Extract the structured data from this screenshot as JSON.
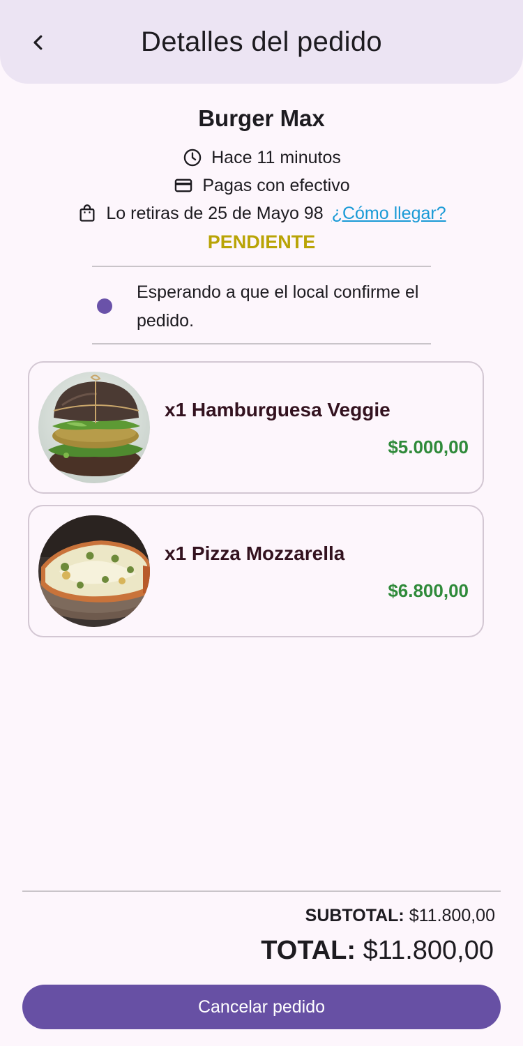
{
  "header": {
    "title": "Detalles del pedido",
    "back_icon": "chevron-left-icon"
  },
  "order": {
    "store_name": "Burger Max",
    "time_text": "Hace 11 minutos",
    "payment_text": "Pagas con efectivo",
    "pickup_text": "Lo retiras de 25 de Mayo 98",
    "directions_link": "¿Cómo llegar?",
    "status": "PENDIENTE",
    "status_color": "#b9a406",
    "progress_message": "Esperando a que el local confirme el pedido."
  },
  "items": [
    {
      "name": "x1 Hamburguesa Veggie",
      "price": "$5.000,00",
      "image": "veggie-burger-photo"
    },
    {
      "name": "x1 Pizza Mozzarella",
      "price": "$6.800,00",
      "image": "mozzarella-pizza-photo"
    }
  ],
  "totals": {
    "subtotal_label": "SUBTOTAL:",
    "subtotal_value": "$11.800,00",
    "total_label": "TOTAL:",
    "total_value": "$11.800,00"
  },
  "actions": {
    "cancel_label": "Cancelar pedido"
  },
  "colors": {
    "accent": "#6750a4",
    "price": "#2f8a3a",
    "link": "#1a9ad6"
  }
}
